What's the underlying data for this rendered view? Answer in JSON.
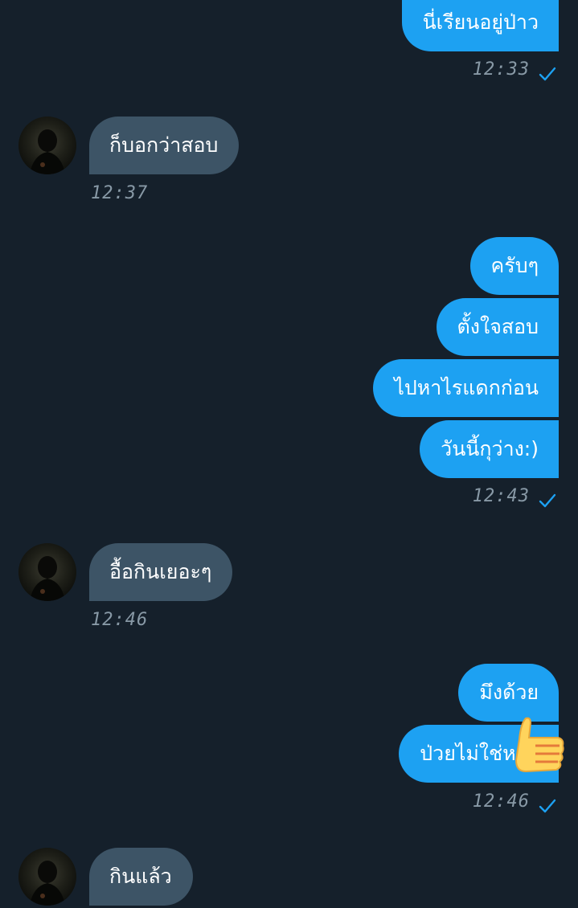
{
  "colors": {
    "background": "#15202b",
    "outgoing_bubble": "#1da1f2",
    "incoming_bubble": "#3d5466",
    "timestamp": "#8899a6",
    "check": "#1da1f2"
  },
  "messages": [
    {
      "direction": "out",
      "text": "นี่เรียนอยู่ป่าว"
    },
    {
      "direction": "out_meta",
      "time": "12:33",
      "icon": "check-icon"
    },
    {
      "direction": "in",
      "text": "ก็บอกว่าสอบ",
      "time": "12:37",
      "icon": "avatar"
    },
    {
      "direction": "out",
      "text": "ครับๆ"
    },
    {
      "direction": "out",
      "text": "ตั้งใจสอบ"
    },
    {
      "direction": "out",
      "text": "ไปหาไรแดกก่อน"
    },
    {
      "direction": "out",
      "text": "วันนี้กุว่าง:)"
    },
    {
      "direction": "out_meta",
      "time": "12:43",
      "icon": "check-icon"
    },
    {
      "direction": "in",
      "text": "อื้อกินเยอะๆ",
      "time": "12:46",
      "icon": "avatar"
    },
    {
      "direction": "out",
      "text": "มึงด้วย"
    },
    {
      "direction": "out",
      "text": "ป่วยไม่ใช่หรอ",
      "sticker": "thumbs-up-sticker"
    },
    {
      "direction": "out_meta",
      "time": "12:46",
      "icon": "check-icon"
    },
    {
      "direction": "in",
      "text": "กินแล้ว",
      "icon": "avatar"
    }
  ]
}
